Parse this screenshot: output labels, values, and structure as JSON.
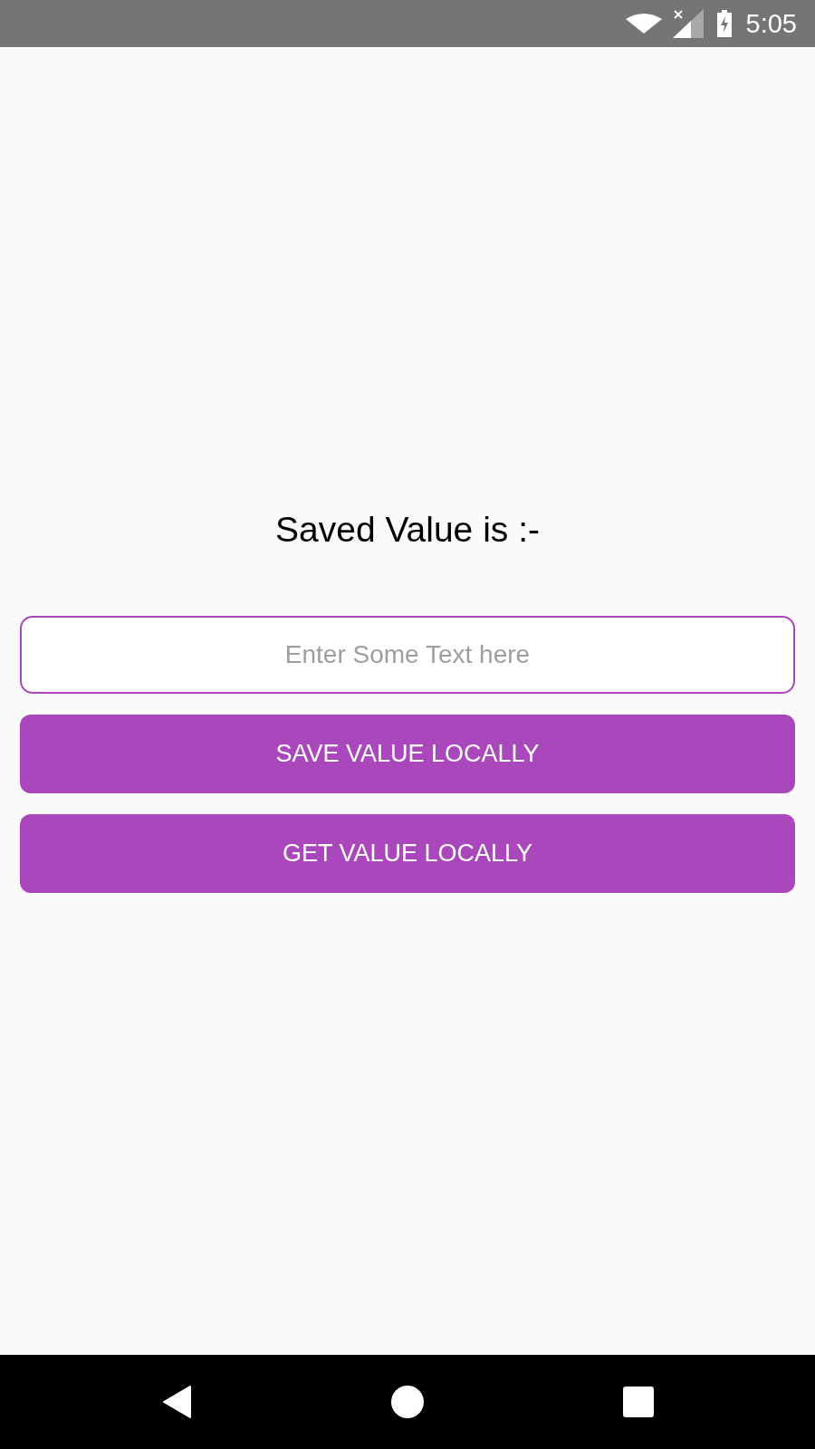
{
  "status_bar": {
    "time": "5:05"
  },
  "title": "Saved Value is :-",
  "input": {
    "placeholder": "Enter Some Text here"
  },
  "buttons": [
    "SAVE VALUE LOCALLY",
    "GET VALUE LOCALLY"
  ]
}
